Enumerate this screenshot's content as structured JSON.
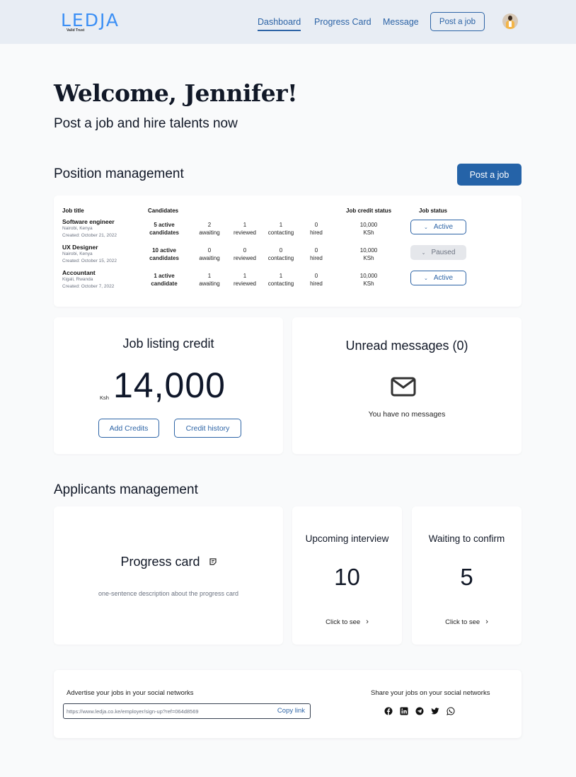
{
  "header": {
    "logo_text": "LEDJA",
    "logo_tagline": "Valid Trust",
    "nav": [
      {
        "label": "Dashboard",
        "active": true
      },
      {
        "label": "Progress Card",
        "active": false
      },
      {
        "label": "Message",
        "active": false
      }
    ],
    "post_job_label": "Post a job",
    "avatar_alt": "user-avatar"
  },
  "welcome": {
    "title": "Welcome, Jennifer!",
    "subtitle": "Post a job and hire talents now"
  },
  "position_management": {
    "title": "Position management",
    "post_job_label": "Post a job",
    "columns": {
      "job_title": "Job title",
      "candidates": "Candidates",
      "credit_status": "Job credit status",
      "job_status": "Job status"
    },
    "rows": [
      {
        "title": "Software engineer",
        "location": "Nairobi, Kenya",
        "created": "Created: October 21, 2022",
        "active_line1": "5 active",
        "active_line2": "candidates",
        "awaiting": "2",
        "awaiting_label": "awaiting",
        "reviewed": "1",
        "reviewed_label": "reviewed",
        "contacting": "1",
        "contacting_label": "contacting",
        "hired": "0",
        "hired_label": "hired",
        "credit": "10,000",
        "credit_unit": "KSh",
        "status": "Active"
      },
      {
        "title": "UX Designer",
        "location": "Nairobi, Kenya",
        "created": "Created: October 15, 2022",
        "active_line1": "10 active",
        "active_line2": "candidates",
        "awaiting": "0",
        "awaiting_label": "awaiting",
        "reviewed": "0",
        "reviewed_label": "reviewed",
        "contacting": "0",
        "contacting_label": "contacting",
        "hired": "0",
        "hired_label": "hired",
        "credit": "10,000",
        "credit_unit": "KSh",
        "status": "Paused"
      },
      {
        "title": "Accountant",
        "location": "Kigali, Rwanda",
        "created": "Created: October 7, 2022",
        "active_line1": "1 active",
        "active_line2": "candidate",
        "awaiting": "1",
        "awaiting_label": "awaiting",
        "reviewed": "1",
        "reviewed_label": "reviewed",
        "contacting": "1",
        "contacting_label": "contacting",
        "hired": "0",
        "hired_label": "hired",
        "credit": "10,000",
        "credit_unit": "KSh",
        "status": "Active"
      }
    ]
  },
  "credit": {
    "title": "Job listing credit",
    "currency": "Ksh",
    "amount": "14,000",
    "add_label": "Add Credits",
    "history_label": "Credit history"
  },
  "messages": {
    "title": "Unread messages (0)",
    "empty_text": "You have no messages"
  },
  "applicants": {
    "title": "Applicants management",
    "progress_card": {
      "title": "Progress card",
      "description": "one-sentence description about the progress card"
    },
    "upcoming": {
      "title": "Upcoming interview",
      "value": "10",
      "link": "Click to see"
    },
    "waiting": {
      "title": "Waiting to confirm",
      "value": "5",
      "link": "Click to see"
    }
  },
  "share": {
    "advertise_label": "Advertise your jobs in your social networks",
    "link_value": "https://www.ledja.co.ke/employer/sign-up?ref=064d8569",
    "copy_label": "Copy link",
    "share_label": "Share your jobs on your social networks",
    "networks": [
      "facebook",
      "linkedin",
      "telegram",
      "twitter",
      "whatsapp"
    ]
  },
  "colors": {
    "brand": "#3b8ff5",
    "primary": "#2563a8",
    "header_bg": "#e8edf4"
  }
}
